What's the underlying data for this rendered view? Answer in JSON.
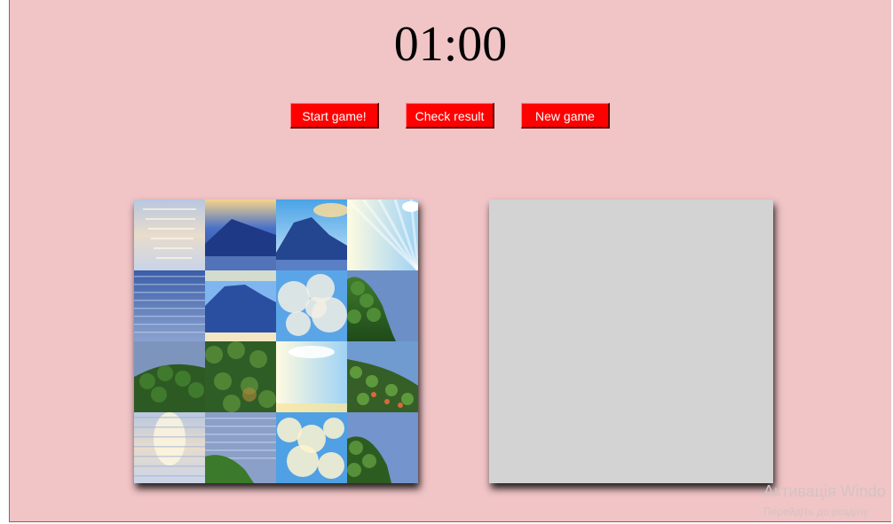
{
  "timer": {
    "value": "01:00"
  },
  "buttons": {
    "start": "Start game!",
    "check": "Check result",
    "new": "New game"
  },
  "colors": {
    "background": "#f1c4c6",
    "button": "#ff0000",
    "target_board": "#d3d3d3"
  },
  "puzzle": {
    "tiles": [
      {
        "scene": "sea-sunlit-top"
      },
      {
        "scene": "mountain-dusk"
      },
      {
        "scene": "mountain-peak-sky"
      },
      {
        "scene": "sky-sunrays"
      },
      {
        "scene": "sea-blue-ripples"
      },
      {
        "scene": "mountain-full"
      },
      {
        "scene": "clouds-dense"
      },
      {
        "scene": "tree-and-sea"
      },
      {
        "scene": "shrubs-and-lake"
      },
      {
        "scene": "hill-green"
      },
      {
        "scene": "sky-bright"
      },
      {
        "scene": "shrubs-flowers"
      },
      {
        "scene": "sea-sunlit-bottom"
      },
      {
        "scene": "lake-hill-edge"
      },
      {
        "scene": "clouds-yellow"
      },
      {
        "scene": "tree-and-sea-2"
      }
    ]
  },
  "target": {
    "tiles": []
  },
  "watermark": {
    "line1": "Активація Windo",
    "line2": "Перейдіть до розділу"
  }
}
